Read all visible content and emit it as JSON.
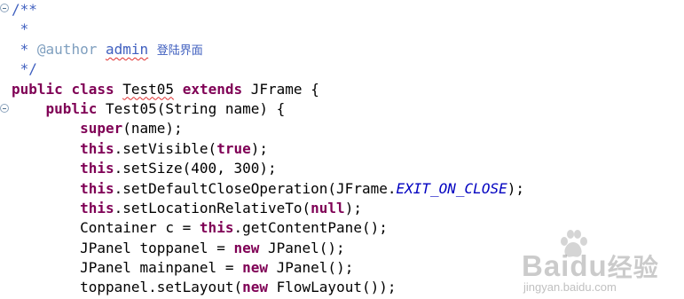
{
  "code": {
    "l1_comment": "/**",
    "l2_comment": " *",
    "l3_star": " * ",
    "l3_tag": "@author",
    "l3_space": " ",
    "l3_name": "admin",
    "l3_desc": "登陆界面",
    "l4_comment": " */",
    "l5_public": "public",
    "l5_class": "class",
    "l5_name": "Test05",
    "l5_extends": "extends",
    "l5_rest": "JFrame {",
    "l6_public": "public",
    "l6_rest": "Test05(String name) {",
    "l7_super": "super",
    "l7_rest": "(name);",
    "l8_this": "this",
    "l8_call": ".setVisible(",
    "l8_true": "true",
    "l8_end": ");",
    "l9_this": "this",
    "l9_rest": ".setSize(400, 300);",
    "l10_this": "this",
    "l10_call": ".setDefaultCloseOperation(JFrame.",
    "l10_const": "EXIT_ON_CLOSE",
    "l10_end": ");",
    "l11_this": "this",
    "l11_call": ".setLocationRelativeTo(",
    "l11_null": "null",
    "l11_end": ");",
    "l12_start": "Container c = ",
    "l12_this": "this",
    "l12_rest": ".getContentPane();",
    "l13_start": "JPanel toppanel = ",
    "l13_new": "new",
    "l13_rest": " JPanel();",
    "l14_start": "JPanel mainpanel = ",
    "l14_new": "new",
    "l14_rest": " JPanel();",
    "l15_start": "toppanel.setLayout(",
    "l15_new": "new",
    "l15_rest": " FlowLayout());"
  },
  "watermark": {
    "brand": "Bai",
    "brand_mid": "du",
    "brand_zh": "经验",
    "url": "jingyan.baidu.com"
  },
  "colors": {
    "keyword": "#7f0055",
    "javadoc": "#3f5fbf",
    "javadoc_tag": "#7f9fbf",
    "constant": "#0000c0"
  },
  "icons": [
    "fold-collapse-icon",
    "baidu-paw-logo-icon"
  ]
}
